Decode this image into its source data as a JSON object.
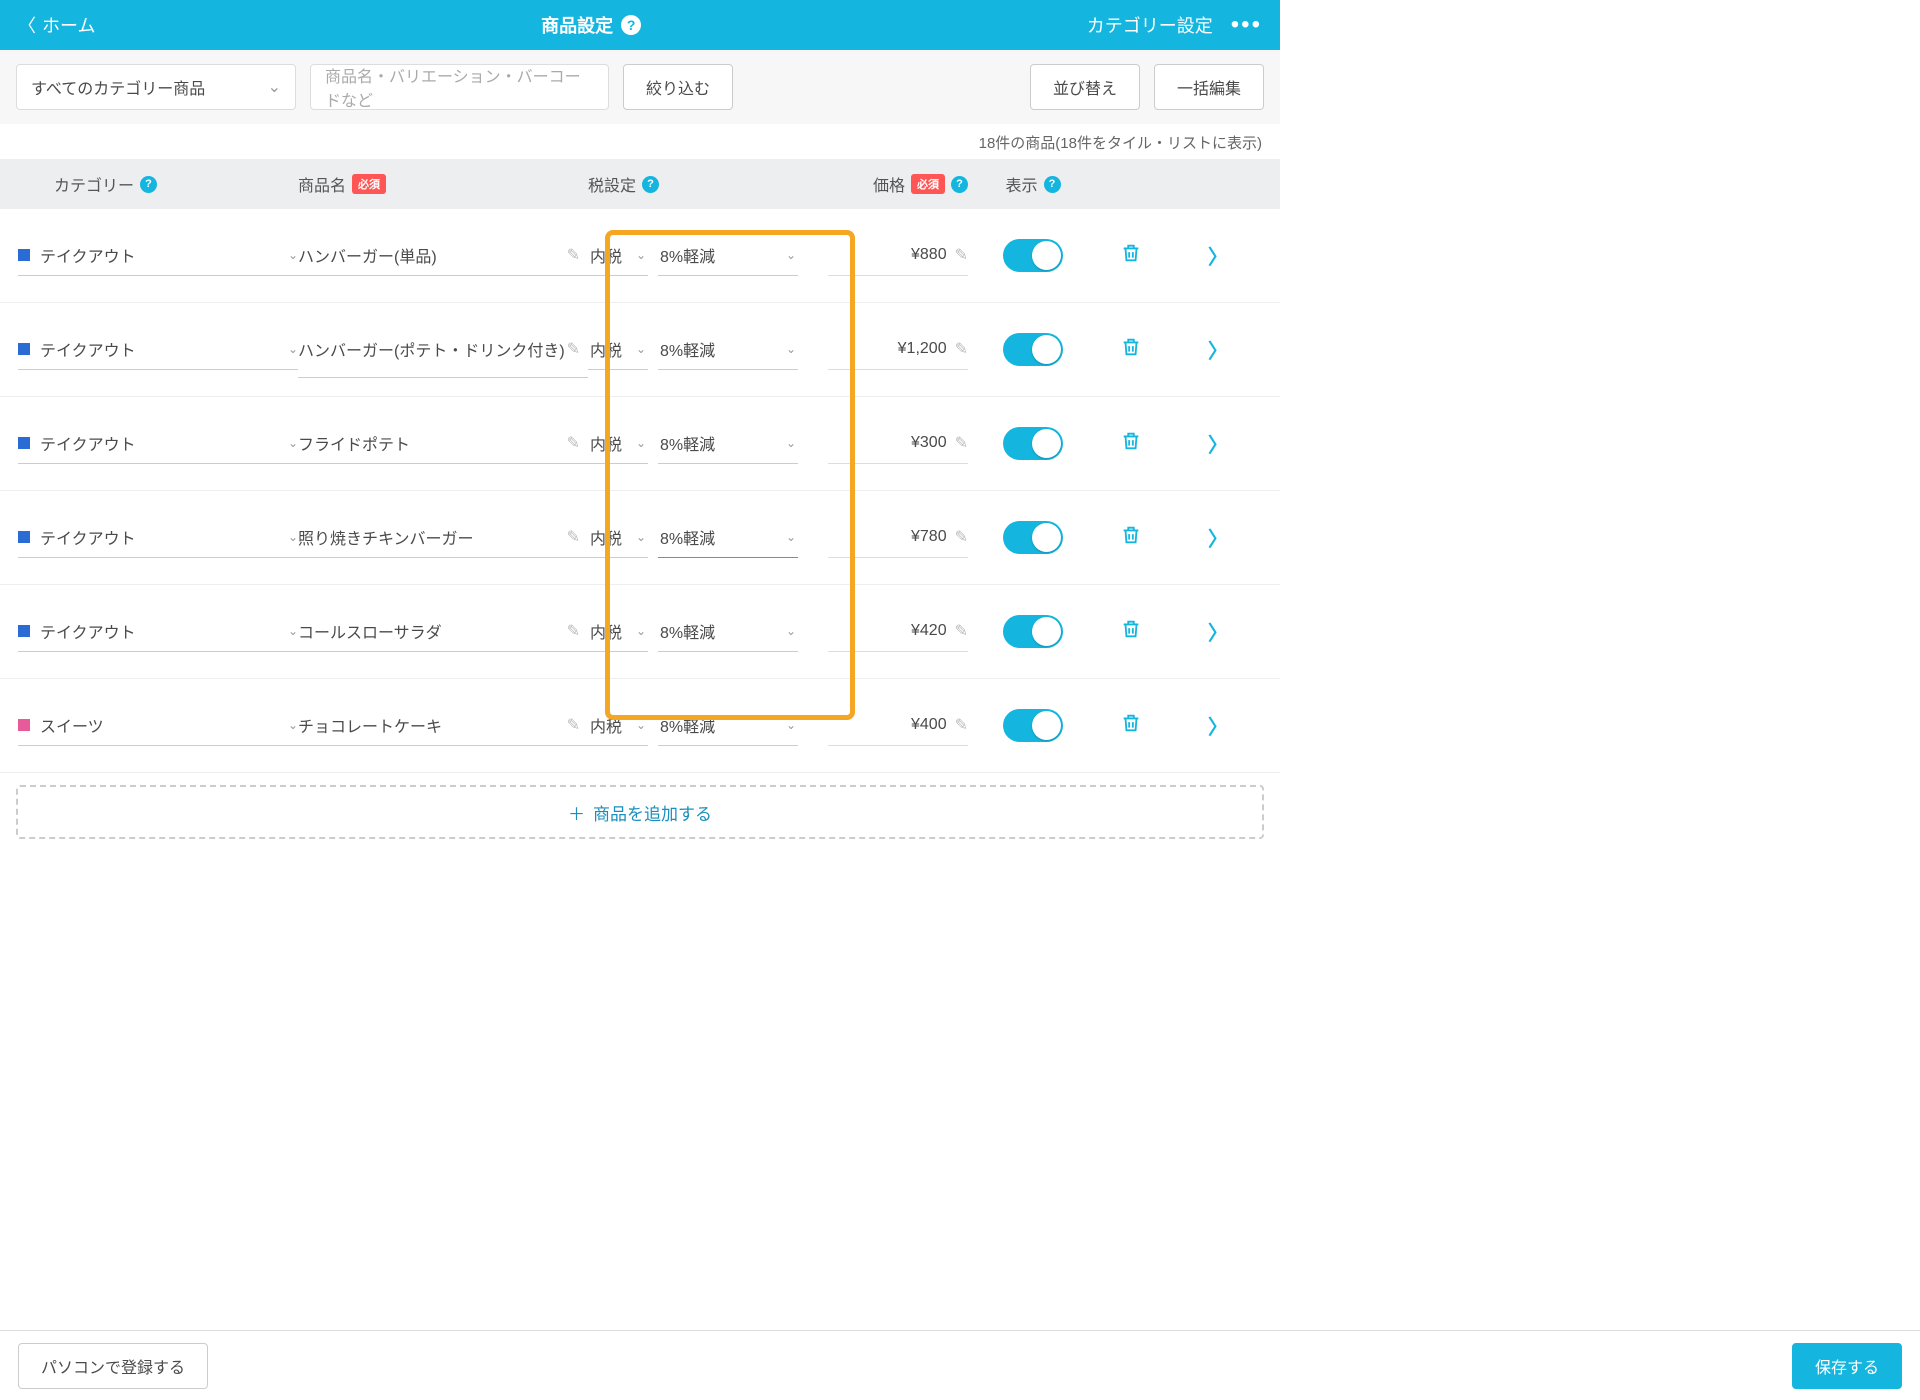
{
  "header": {
    "back": "ホーム",
    "title": "商品設定",
    "right_link": "カテゴリー設定"
  },
  "toolbar": {
    "category_filter": "すべてのカテゴリー商品",
    "search_placeholder": "商品名・バリエーション・バーコードなど",
    "filter_btn": "絞り込む",
    "sort_btn": "並び替え",
    "bulk_btn": "一括編集"
  },
  "count_text": "18件の商品(18件をタイル・リストに表示)",
  "columns": {
    "category": "カテゴリー",
    "name": "商品名",
    "tax": "税設定",
    "price": "価格",
    "display": "表示",
    "required": "必須"
  },
  "rows": [
    {
      "cat": "テイクアウト",
      "color": "#2a6bd4",
      "name": "ハンバーガー(単品)",
      "tax1": "内税",
      "tax2": "8%軽減",
      "price": "¥880",
      "tall": false,
      "active": false
    },
    {
      "cat": "テイクアウト",
      "color": "#2a6bd4",
      "name": "ハンバーガー(ポテト・ドリンク付き)",
      "tax1": "内税",
      "tax2": "8%軽減",
      "price": "¥1,200",
      "tall": true,
      "active": false
    },
    {
      "cat": "テイクアウト",
      "color": "#2a6bd4",
      "name": "フライドポテト",
      "tax1": "内税",
      "tax2": "8%軽減",
      "price": "¥300",
      "tall": false,
      "active": false
    },
    {
      "cat": "テイクアウト",
      "color": "#2a6bd4",
      "name": "照り焼きチキンバーガー",
      "tax1": "内税",
      "tax2": "8%軽減",
      "price": "¥780",
      "tall": false,
      "active": true
    },
    {
      "cat": "テイクアウト",
      "color": "#2a6bd4",
      "name": "コールスローサラダ",
      "tax1": "内税",
      "tax2": "8%軽減",
      "price": "¥420",
      "tall": false,
      "active": false
    },
    {
      "cat": "スイーツ",
      "color": "#e85b9b",
      "name": "チョコレートケーキ",
      "tax1": "内税",
      "tax2": "8%軽減",
      "price": "¥400",
      "tall": false,
      "active": false
    }
  ],
  "add_row": "商品を追加する",
  "footer": {
    "left": "パソコンで登録する",
    "save": "保存する"
  }
}
